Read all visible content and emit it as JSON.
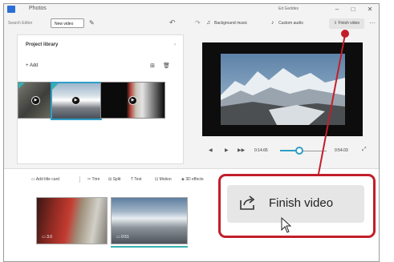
{
  "app": {
    "title": "Photos",
    "user": "Ed Geddes"
  },
  "window_controls": {
    "minimize": "–",
    "maximize": "□",
    "close": "✕"
  },
  "toolbar": {
    "crumb": "Search Editor",
    "project_name": "New video",
    "background_music": "Background music",
    "custom_audio": "Custom audio",
    "finish_video": "Finish video",
    "more": "···"
  },
  "library": {
    "title": "Project library",
    "add": "+ Add",
    "collapse": "‹"
  },
  "playback": {
    "current_time": "0:14.65",
    "total_time": "0:54.03",
    "progress": 0.42
  },
  "storyboard": {
    "tools": [
      "Add title card",
      "Trim",
      "Split",
      "Text",
      "Motion",
      "3D effects"
    ],
    "clips": [
      {
        "duration": "3.0"
      },
      {
        "duration": "0:51"
      }
    ]
  },
  "callout": {
    "finish_video": "Finish video"
  },
  "colors": {
    "accent": "#2e9ec7",
    "highlight": "#c21e2a",
    "clip_marker": "#36b0b0"
  }
}
